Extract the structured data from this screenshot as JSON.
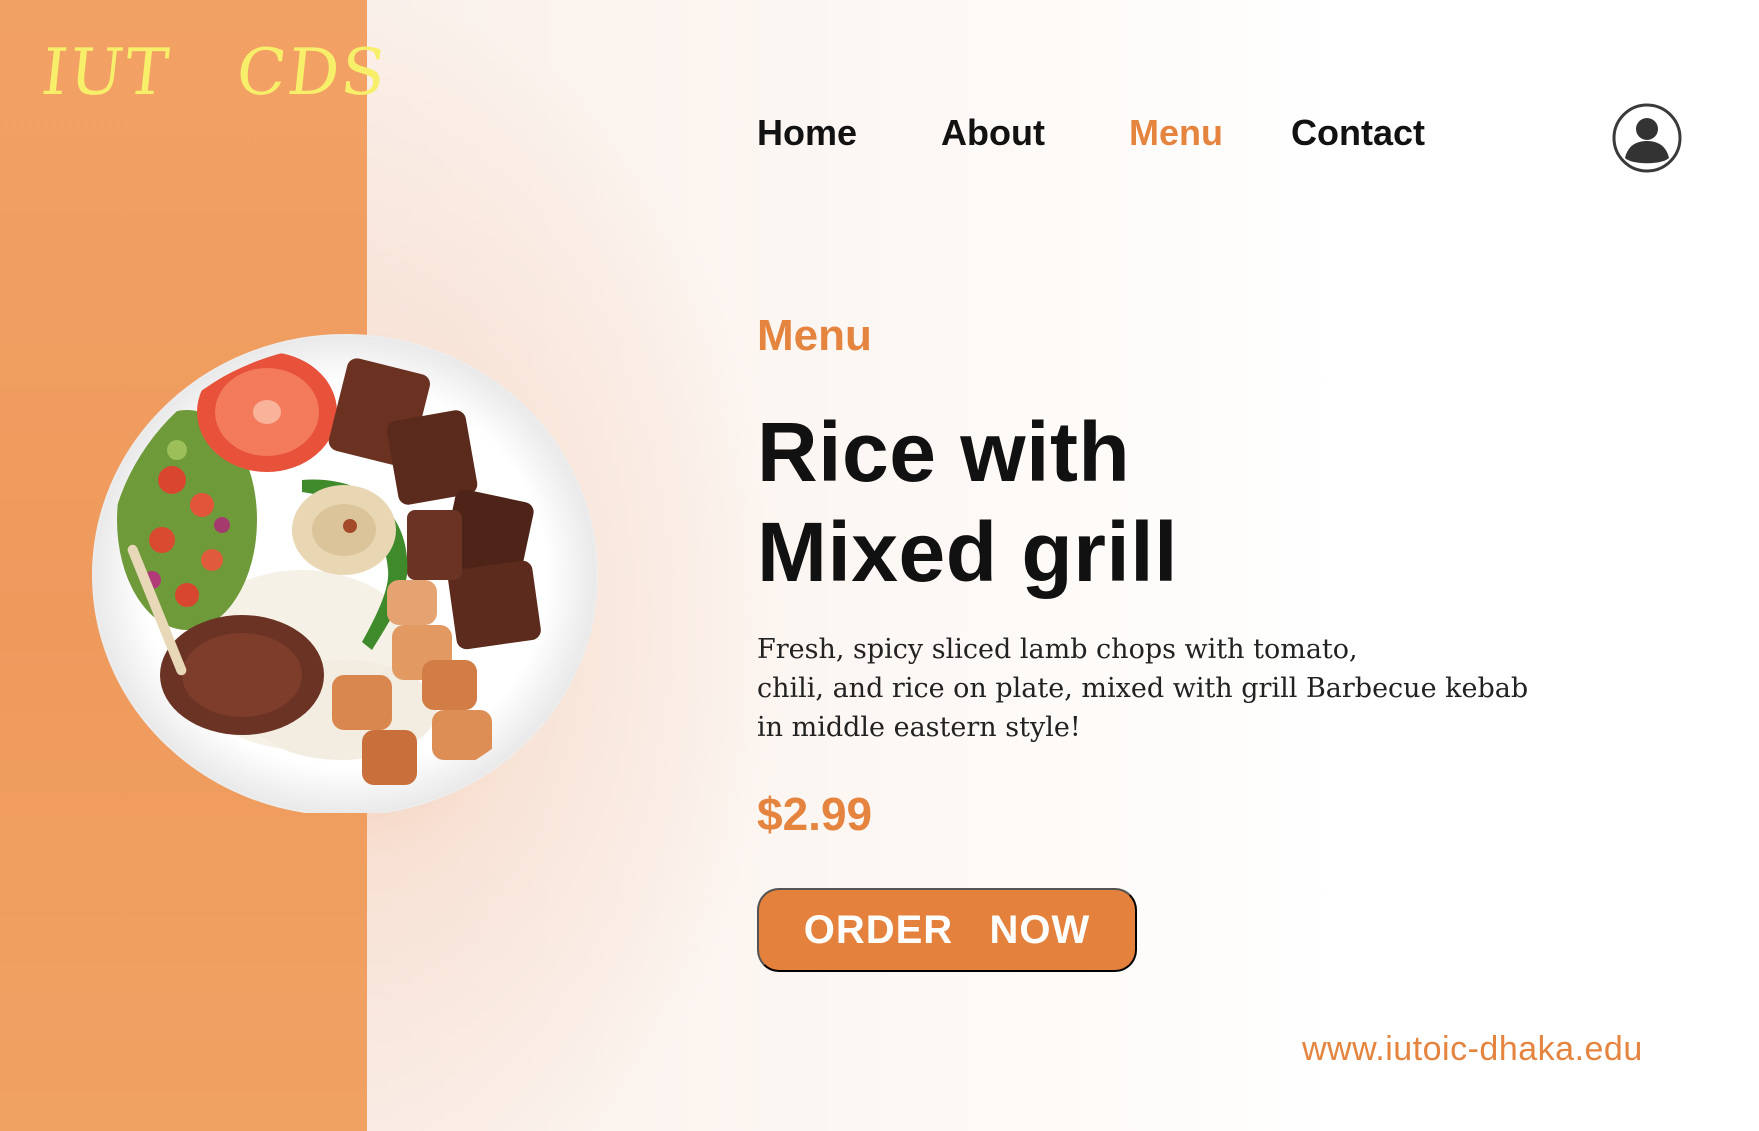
{
  "brand": {
    "logo_text": "IUT   CDS"
  },
  "nav": {
    "items": [
      {
        "label": "Home",
        "active": false
      },
      {
        "label": "About",
        "active": false
      },
      {
        "label": "Menu",
        "active": true
      },
      {
        "label": "Contact",
        "active": false
      }
    ],
    "profile_icon": "user-circle-icon"
  },
  "hero": {
    "eyebrow": "Menu",
    "title_line1": "Rice with",
    "title_line2": "Mixed grill",
    "description_lines": [
      "Fresh, spicy sliced lamb chops with tomato,",
      "chili, and rice on plate, mixed with grill Barbecue kebab",
      "in middle eastern style!"
    ],
    "price": "$2.99",
    "cta_label": "ORDER   NOW",
    "image_alt": "mixed-grill-plate"
  },
  "footer": {
    "url": "www.iutoic-dhaka.edu"
  },
  "colors": {
    "accent": "#e4843f",
    "left_band": "#f0a061",
    "logo": "#f7ef6a",
    "text_dark": "#111111"
  }
}
